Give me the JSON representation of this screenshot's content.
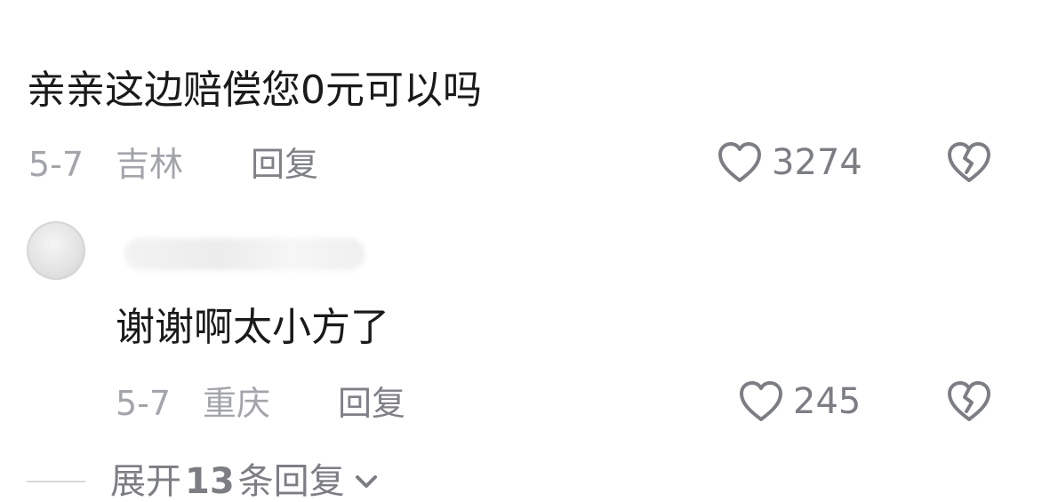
{
  "comments": [
    {
      "text": "亲亲这边赔偿您0元可以吗",
      "date": "5-7",
      "location": "吉林",
      "reply_label": "回复",
      "likes": "3274"
    },
    {
      "text": "谢谢啊太小方了",
      "date": "5-7",
      "location": "重庆",
      "reply_label": "回复",
      "likes": "245"
    }
  ],
  "expand_replies": {
    "prefix": "展开",
    "count": "13",
    "suffix": "条回复"
  },
  "icons": {
    "like": "heart-outline-icon",
    "dislike": "broken-heart-icon",
    "expand": "chevron-down-icon"
  },
  "colors": {
    "text_primary": "#1a1a1a",
    "text_meta": "#a3a5ab",
    "text_secondary": "#7c7e84"
  }
}
